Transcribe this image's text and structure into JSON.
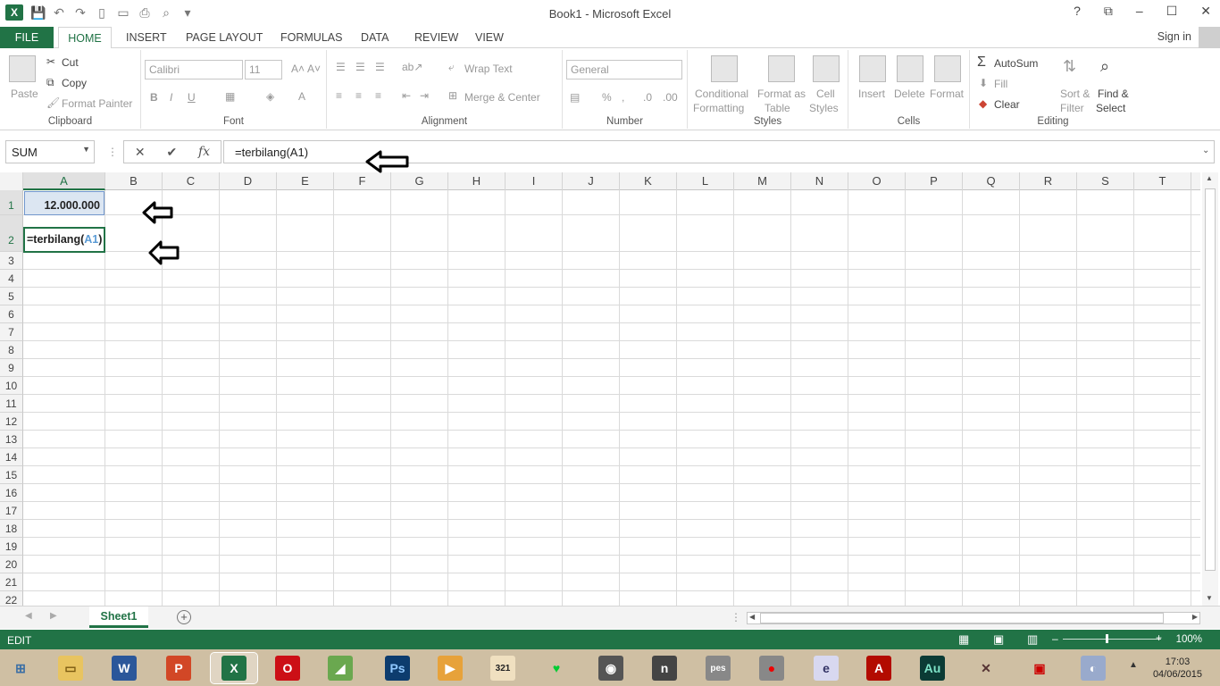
{
  "window": {
    "title": "Book1 - Microsoft Excel"
  },
  "ribbon_tabs": [
    "FILE",
    "HOME",
    "INSERT",
    "PAGE LAYOUT",
    "FORMULAS",
    "DATA",
    "REVIEW",
    "VIEW"
  ],
  "account": {
    "sign_in": "Sign in"
  },
  "clipboard": {
    "paste": "Paste",
    "cut": "Cut",
    "copy": "Copy",
    "format_painter": "Format Painter",
    "label": "Clipboard"
  },
  "font": {
    "name": "Calibri",
    "size": "11",
    "label": "Font",
    "bold": "B",
    "italic": "I",
    "underline": "U"
  },
  "alignment": {
    "wrap_text": "Wrap Text",
    "merge_center": "Merge & Center",
    "label": "Alignment"
  },
  "number": {
    "format": "General",
    "percent": "%",
    "label": "Number"
  },
  "styles": {
    "conditional": "Conditional",
    "formatting": "Formatting",
    "format_as": "Format as",
    "table": "Table",
    "cell": "Cell",
    "cell_styles": "Styles",
    "label": "Styles"
  },
  "cells": {
    "insert": "Insert",
    "delete": "Delete",
    "format": "Format",
    "label": "Cells"
  },
  "editing": {
    "autosum": "AutoSum",
    "fill": "Fill",
    "clear": "Clear",
    "sort": "Sort &",
    "filter": "Filter",
    "find": "Find &",
    "select": "Select",
    "label": "Editing"
  },
  "formula_bar": {
    "name_box": "SUM",
    "formula": "=terbilang(A1)",
    "fx": "fx"
  },
  "columns": [
    "A",
    "B",
    "C",
    "D",
    "E",
    "F",
    "G",
    "H",
    "I",
    "J",
    "K",
    "L",
    "M",
    "N",
    "O",
    "P",
    "Q",
    "R",
    "S",
    "T"
  ],
  "rows": [
    "1",
    "2",
    "3",
    "4",
    "5",
    "6",
    "7",
    "8",
    "9",
    "10",
    "11",
    "12",
    "13",
    "14",
    "15",
    "16",
    "17",
    "18",
    "19",
    "20",
    "21",
    "22"
  ],
  "cells_data": {
    "a1": "12.000.000",
    "a2_prefix": "=terbilang(",
    "a2_ref": "A1",
    "a2_suffix": ")"
  },
  "sheets": {
    "active": "Sheet1"
  },
  "status": {
    "mode": "EDIT",
    "zoom": "100%"
  },
  "clock": {
    "time": "17:03",
    "date": "04/06/2015"
  },
  "taskbar_apps": [
    "windows-start",
    "file-explorer",
    "word",
    "powerpoint",
    "excel",
    "opera",
    "corel",
    "photoshop",
    "media-player",
    "calendar-321",
    "heart-app",
    "camera-app",
    "nero",
    "pes-galaxy",
    "record-app",
    "emis",
    "acrobat",
    "audition",
    "game-app",
    "network-app",
    "paint-app"
  ]
}
